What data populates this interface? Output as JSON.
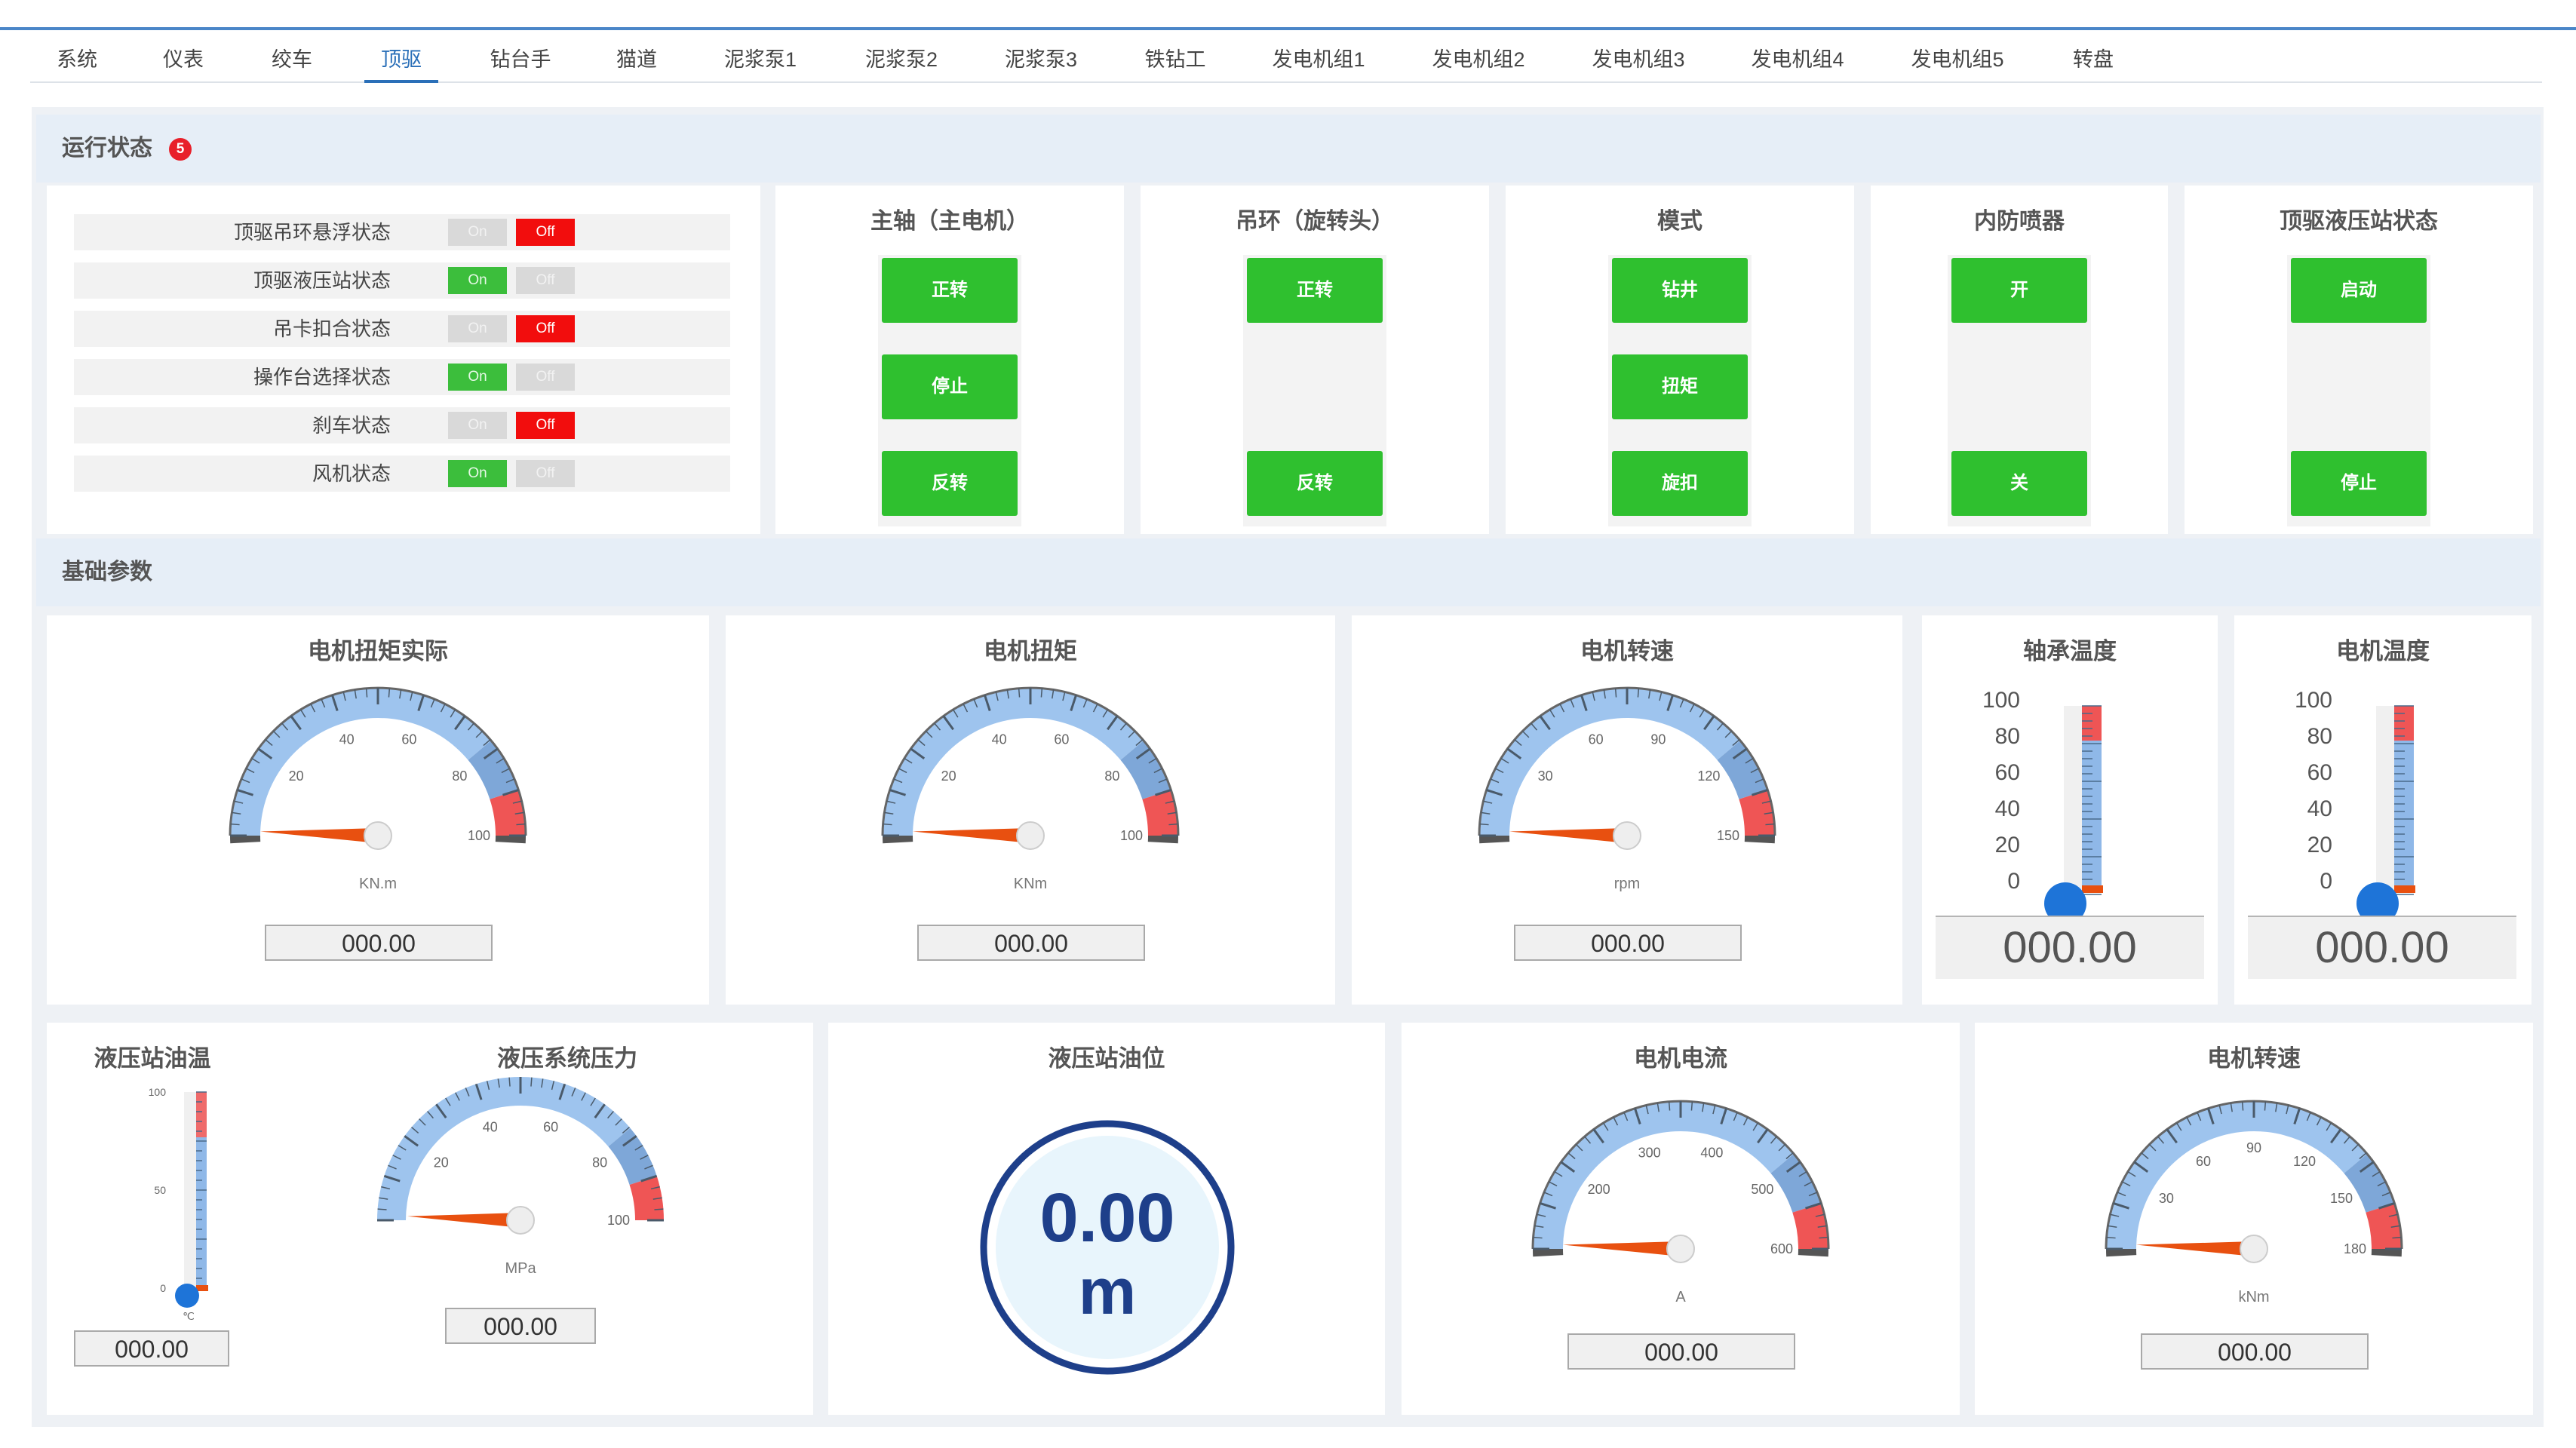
{
  "tabs": [
    "系统",
    "仪表",
    "绞车",
    "顶驱",
    "钻台手",
    "猫道",
    "泥浆泵1",
    "泥浆泵2",
    "泥浆泵3",
    "铁钻工",
    "发电机组1",
    "发电机组2",
    "发电机组3",
    "发电机组4",
    "发电机组5",
    "转盘"
  ],
  "active_tab": "顶驱",
  "status_section": {
    "title": "运行状态",
    "badge": "5",
    "on_label": "On",
    "off_label": "Off",
    "rows": [
      {
        "label": "顶驱吊环悬浮状态",
        "state": "off"
      },
      {
        "label": "顶驱液压站状态",
        "state": "on"
      },
      {
        "label": "吊卡扣合状态",
        "state": "off"
      },
      {
        "label": "操作台选择状态",
        "state": "on"
      },
      {
        "label": "刹车状态",
        "state": "off"
      },
      {
        "label": "风机状态",
        "state": "on"
      }
    ]
  },
  "controls": [
    {
      "title": "主轴（主电机）",
      "buttons": [
        "正转",
        "停止",
        "反转"
      ],
      "slots": [
        0,
        1,
        2
      ]
    },
    {
      "title": "吊环（旋转头）",
      "buttons": [
        "正转",
        "反转"
      ],
      "slots": [
        0,
        2
      ]
    },
    {
      "title": "模式",
      "buttons": [
        "钻井",
        "扭矩",
        "旋扣"
      ],
      "slots": [
        0,
        1,
        2
      ]
    },
    {
      "title": "内防喷器",
      "buttons": [
        "开",
        "关"
      ],
      "slots": [
        0,
        2
      ]
    },
    {
      "title": "顶驱液压站状态",
      "buttons": [
        "启动",
        "停止"
      ],
      "slots": [
        0,
        2
      ]
    }
  ],
  "params_section": {
    "title": "基础参数"
  },
  "gauges": [
    {
      "id": "g1",
      "title": "电机扭矩实际",
      "unit": "KN.m",
      "ticks": [
        "20",
        "40",
        "60",
        "80",
        "100"
      ],
      "value": 0,
      "max": 100,
      "readout": "000.00"
    },
    {
      "id": "g2",
      "title": "电机扭矩",
      "unit": "KNm",
      "ticks": [
        "20",
        "40",
        "60",
        "80",
        "100"
      ],
      "value": 0,
      "max": 100,
      "readout": "000.00"
    },
    {
      "id": "g3",
      "title": "电机转速",
      "unit": "rpm",
      "ticks": [
        "30",
        "60",
        "90",
        "120",
        "150"
      ],
      "value": 0,
      "max": 150,
      "readout": "000.00"
    },
    {
      "id": "g4",
      "title": "液压系统压力",
      "unit": "MPa",
      "ticks": [
        "20",
        "40",
        "60",
        "80",
        "100"
      ],
      "value": 0,
      "max": 100,
      "readout": "000.00"
    },
    {
      "id": "g5",
      "title": "电机电流",
      "unit": "A",
      "ticks": [
        "200",
        "300",
        "400",
        "500",
        "600"
      ],
      "value": 0,
      "max": 600,
      "readout": "000.00"
    },
    {
      "id": "g6",
      "title": "电机转速",
      "unit": "kNm",
      "ticks": [
        "30",
        "60",
        "90",
        "120",
        "150",
        "180"
      ],
      "value": 0,
      "max": 180,
      "readout": "000.00"
    }
  ],
  "thermometers": [
    {
      "id": "t1",
      "title": "轴承温度",
      "scale": [
        "100",
        "80",
        "60",
        "40",
        "20",
        "0"
      ],
      "value": 0,
      "readout": "000.00"
    },
    {
      "id": "t2",
      "title": "电机温度",
      "scale": [
        "100",
        "80",
        "60",
        "40",
        "20",
        "0"
      ],
      "value": 0,
      "readout": "000.00"
    }
  ],
  "oil_temp": {
    "title": "液压站油温",
    "scale": [
      "100",
      "50",
      "0"
    ],
    "unit": "℃",
    "value": 0,
    "readout": "000.00"
  },
  "oil_level": {
    "title": "液压站油位",
    "value": "0.00",
    "unit": "m"
  },
  "colors": {
    "accent": "#2a6fb8",
    "on": "#3cbe3c",
    "off": "#f20d0d",
    "button": "#2fc02f",
    "gauge_arc": "#8fb8e8",
    "gauge_red": "#ef5555",
    "needle": "#e85010",
    "level_ring": "#1e3f8a"
  }
}
